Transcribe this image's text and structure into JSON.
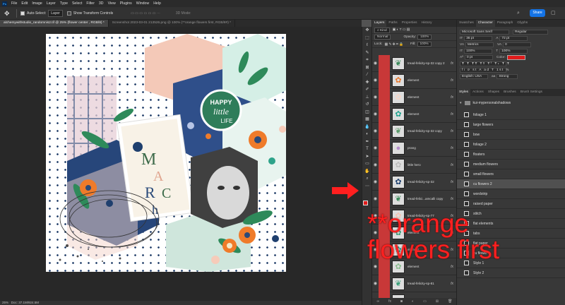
{
  "app": {
    "logo": "Ps"
  },
  "menu": [
    "File",
    "Edit",
    "Image",
    "Layer",
    "Type",
    "Select",
    "Filter",
    "3D",
    "View",
    "Plugins",
    "Window",
    "Help"
  ],
  "options": {
    "auto_select": "Auto-Select:",
    "layer_target": "Layer",
    "show_transform": "Show Transform Controls",
    "mode_3d": "3D Mode:",
    "share": "Share"
  },
  "tabs": [
    {
      "label": "alchemywithstudio_randomnis2.tif @ 25% (flower center , RGB/8) *",
      "active": true
    },
    {
      "label": "Screenshot 2023-03-01 213526.png @ 100% (**orange flowers first, RGB/8#) *",
      "active": false
    }
  ],
  "status": {
    "zoom": "25%",
    "doc": "Doc: 37.1M/924.5M"
  },
  "panel_tabs": [
    "Layers",
    "Paths",
    "Properties",
    "History"
  ],
  "layers_controls": {
    "kind": "Kind",
    "blend": "Normal",
    "opacity_label": "Opacity:",
    "opacity": "100%",
    "lock_label": "Lock:",
    "fill_label": "Fill:",
    "fill": "100%"
  },
  "layers": [
    {
      "name": "tread-felicity-sp-32 copy 2",
      "thumb": "leaf",
      "color": "#3a8a5a"
    },
    {
      "name": "element",
      "thumb": "flower",
      "color": "#e8782c"
    },
    {
      "name": "element",
      "thumb": "flower",
      "color": "#f5d6c7"
    },
    {
      "name": "element",
      "thumb": "flower",
      "color": "#1fa38f"
    },
    {
      "name": "tread-felicity-sp-32 copy",
      "thumb": "leaf",
      "color": "#5a9a6a"
    },
    {
      "name": "prang",
      "thumb": "circle",
      "color": "#b58fcc"
    },
    {
      "name": "little hero",
      "thumb": "flower",
      "color": "#bdbdbd"
    },
    {
      "name": "tread-felicity-sp-32",
      "thumb": "flower",
      "color": "#1c3f6e"
    },
    {
      "name": "tread-felici...amcalli copy",
      "thumb": "leaf",
      "color": "#3a8a5a"
    },
    {
      "name": "tread-felicity-sp-77",
      "thumb": "flower",
      "color": "#f3c3b3"
    },
    {
      "name": "element",
      "thumb": "flower",
      "color": "#3aa07a"
    },
    {
      "name": "element",
      "thumb": "flower",
      "color": "#1fa38f"
    },
    {
      "name": "element",
      "thumb": "flower",
      "color": "#8abd8e"
    },
    {
      "name": "tread-felicity-sp-81",
      "thumb": "leaf",
      "color": "#3aa07a"
    },
    {
      "name": "tread-felicity-sp-75",
      "thumb": "circle",
      "color": "#dddddd"
    }
  ],
  "char_tabs": [
    "Swatches",
    "Character",
    "Paragraph",
    "Glyphs"
  ],
  "character": {
    "font": "Microsoft Sans Serif",
    "style": "Regular",
    "size": "36 pt",
    "leading": "72 pt",
    "kerning": "Metrics",
    "tracking": "0",
    "vscale": "100%",
    "hscale": "100%",
    "baseline": "0 pt",
    "color_label": "Color:",
    "color": "#e01b1b",
    "language": "English: USA",
    "aa": "aa",
    "aa_mode": "Strong"
  },
  "style_tabs": [
    "Styles",
    "Actions",
    "Shapes",
    "Brushes",
    "Brush Settings"
  ],
  "styles_group": "kui-mypersonalshadows",
  "styles": [
    {
      "name": "foliage 1"
    },
    {
      "name": "large flowers"
    },
    {
      "name": "bow"
    },
    {
      "name": "foliage 2"
    },
    {
      "name": "floaters"
    },
    {
      "name": "medium flowers"
    },
    {
      "name": "small flowers"
    },
    {
      "name": "cu flowers 2",
      "selected": true
    },
    {
      "name": "wordstrip"
    },
    {
      "name": "raised paper"
    },
    {
      "name": "stitch"
    },
    {
      "name": "flat elements"
    },
    {
      "name": "tabs"
    },
    {
      "name": "flat paper"
    },
    {
      "name": "cu flower"
    },
    {
      "name": "Style 1"
    },
    {
      "name": "Style 2"
    }
  ],
  "canvas_text": {
    "word1": "HAPPY",
    "word2": "little",
    "word3": "LIFE",
    "word4": "M",
    "word5": "A",
    "word6": "R",
    "word7": "C",
    "word8": "h"
  },
  "annotation": "**orange\nflowers first",
  "annotation_lines": [
    "**orange",
    "flowers first"
  ]
}
